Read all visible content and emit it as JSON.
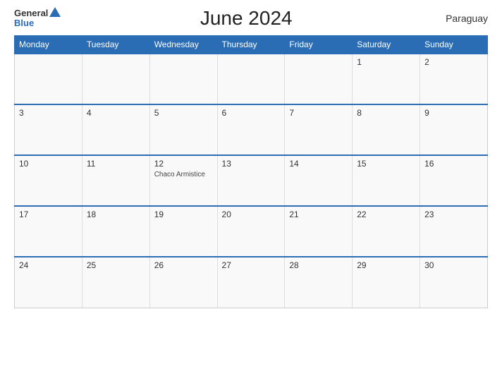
{
  "header": {
    "logo_general": "General",
    "logo_blue": "Blue",
    "title": "June 2024",
    "country": "Paraguay"
  },
  "weekdays": [
    "Monday",
    "Tuesday",
    "Wednesday",
    "Thursday",
    "Friday",
    "Saturday",
    "Sunday"
  ],
  "weeks": [
    [
      {
        "day": "",
        "event": ""
      },
      {
        "day": "",
        "event": ""
      },
      {
        "day": "",
        "event": ""
      },
      {
        "day": "",
        "event": ""
      },
      {
        "day": "",
        "event": ""
      },
      {
        "day": "1",
        "event": ""
      },
      {
        "day": "2",
        "event": ""
      }
    ],
    [
      {
        "day": "3",
        "event": ""
      },
      {
        "day": "4",
        "event": ""
      },
      {
        "day": "5",
        "event": ""
      },
      {
        "day": "6",
        "event": ""
      },
      {
        "day": "7",
        "event": ""
      },
      {
        "day": "8",
        "event": ""
      },
      {
        "day": "9",
        "event": ""
      }
    ],
    [
      {
        "day": "10",
        "event": ""
      },
      {
        "day": "11",
        "event": ""
      },
      {
        "day": "12",
        "event": "Chaco Armistice"
      },
      {
        "day": "13",
        "event": ""
      },
      {
        "day": "14",
        "event": ""
      },
      {
        "day": "15",
        "event": ""
      },
      {
        "day": "16",
        "event": ""
      }
    ],
    [
      {
        "day": "17",
        "event": ""
      },
      {
        "day": "18",
        "event": ""
      },
      {
        "day": "19",
        "event": ""
      },
      {
        "day": "20",
        "event": ""
      },
      {
        "day": "21",
        "event": ""
      },
      {
        "day": "22",
        "event": ""
      },
      {
        "day": "23",
        "event": ""
      }
    ],
    [
      {
        "day": "24",
        "event": ""
      },
      {
        "day": "25",
        "event": ""
      },
      {
        "day": "26",
        "event": ""
      },
      {
        "day": "27",
        "event": ""
      },
      {
        "day": "28",
        "event": ""
      },
      {
        "day": "29",
        "event": ""
      },
      {
        "day": "30",
        "event": ""
      }
    ]
  ]
}
